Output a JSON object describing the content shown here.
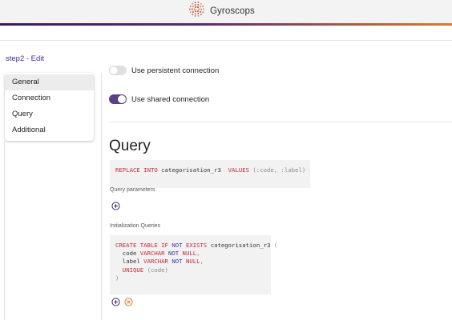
{
  "header": {
    "brand": "Gyroscops"
  },
  "breadcrumb": {
    "text": "step2 - Edit"
  },
  "sidebar": {
    "items": [
      {
        "label": "General"
      },
      {
        "label": "Connection"
      },
      {
        "label": "Query"
      },
      {
        "label": "Additional"
      }
    ]
  },
  "settings": {
    "persistent_label": "Use persistent connection",
    "shared_label": "Use shared connection"
  },
  "query": {
    "title": "Query",
    "code_tokens": {
      "replace": "REPLACE",
      "into": "INTO",
      "table": "categorisation_r3",
      "values": "VALUES",
      "params": "(:code, :label)"
    },
    "parameters_label": "Query parameters"
  },
  "init": {
    "label": "Initialization Queries",
    "tokens": {
      "create": "CREATE",
      "table_kw": "TABLE",
      "if": "IF",
      "not": "NOT",
      "exists": "EXISTS",
      "table": "categorisation_r3",
      "open": "(",
      "code": "code",
      "varchar": "VARCHAR",
      "null": "NULL",
      "comma": ",",
      "label": "label",
      "unique": "UNIQUE",
      "unique_args": "(code)",
      "close": ")"
    }
  },
  "icons": {
    "logo": "gyroscops-logo-icon",
    "add": "plus-circle-icon",
    "remove": "x-circle-icon"
  },
  "colors": {
    "accent_purple": "#5b3f87",
    "accent_orange": "#e07a2a",
    "keyword_red": "#c62b3a",
    "keyword_blue": "#3d37a8"
  }
}
